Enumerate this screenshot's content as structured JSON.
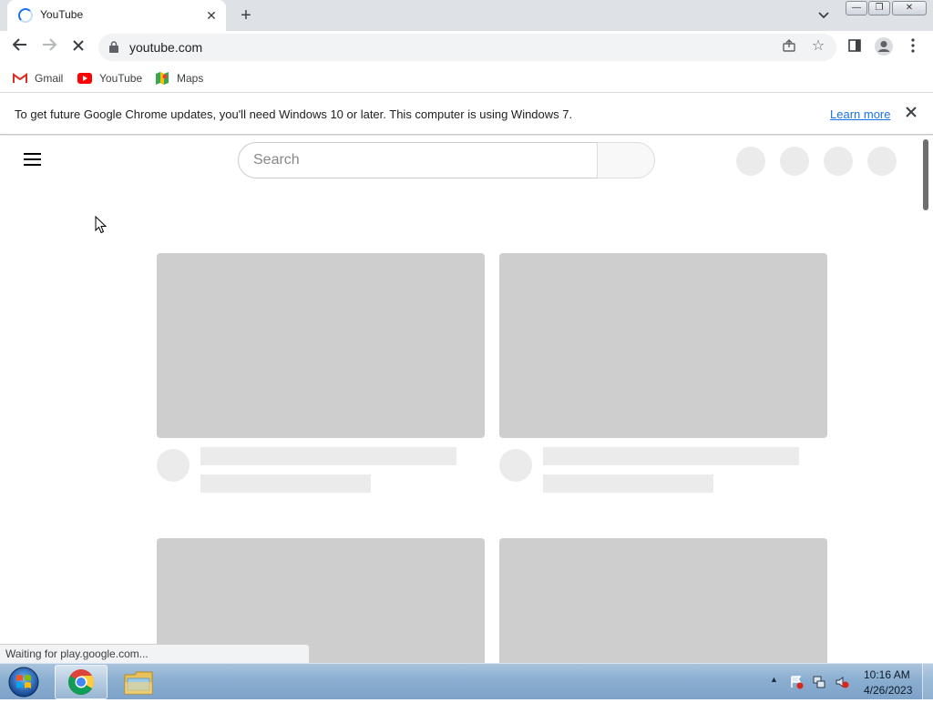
{
  "browser": {
    "tab": {
      "title": "YouTube",
      "close_glyph": "✕"
    },
    "new_tab_glyph": "+",
    "window_controls": {
      "minimize": "—",
      "restore": "❐",
      "close": "✕"
    },
    "toolbar": {
      "url": "youtube.com"
    },
    "bookmarks": [
      {
        "label": "Gmail",
        "icon": "gmail-icon"
      },
      {
        "label": "YouTube",
        "icon": "youtube-icon"
      },
      {
        "label": "Maps",
        "icon": "maps-icon"
      }
    ],
    "infobar": {
      "message": "To get future Google Chrome updates, you'll need Windows 10 or later. This computer is using Windows 7.",
      "link": "Learn more"
    },
    "status": "Waiting for play.google.com..."
  },
  "page": {
    "search_placeholder": "Search"
  },
  "taskbar": {
    "time": "10:16 AM",
    "date": "4/26/2023"
  },
  "colors": {
    "tabstrip": "#dee1e6",
    "skeleton_thumb": "#cecece",
    "skeleton_line": "#ebebeb",
    "link": "#1a73e8",
    "youtube_red": "#ff0000"
  }
}
